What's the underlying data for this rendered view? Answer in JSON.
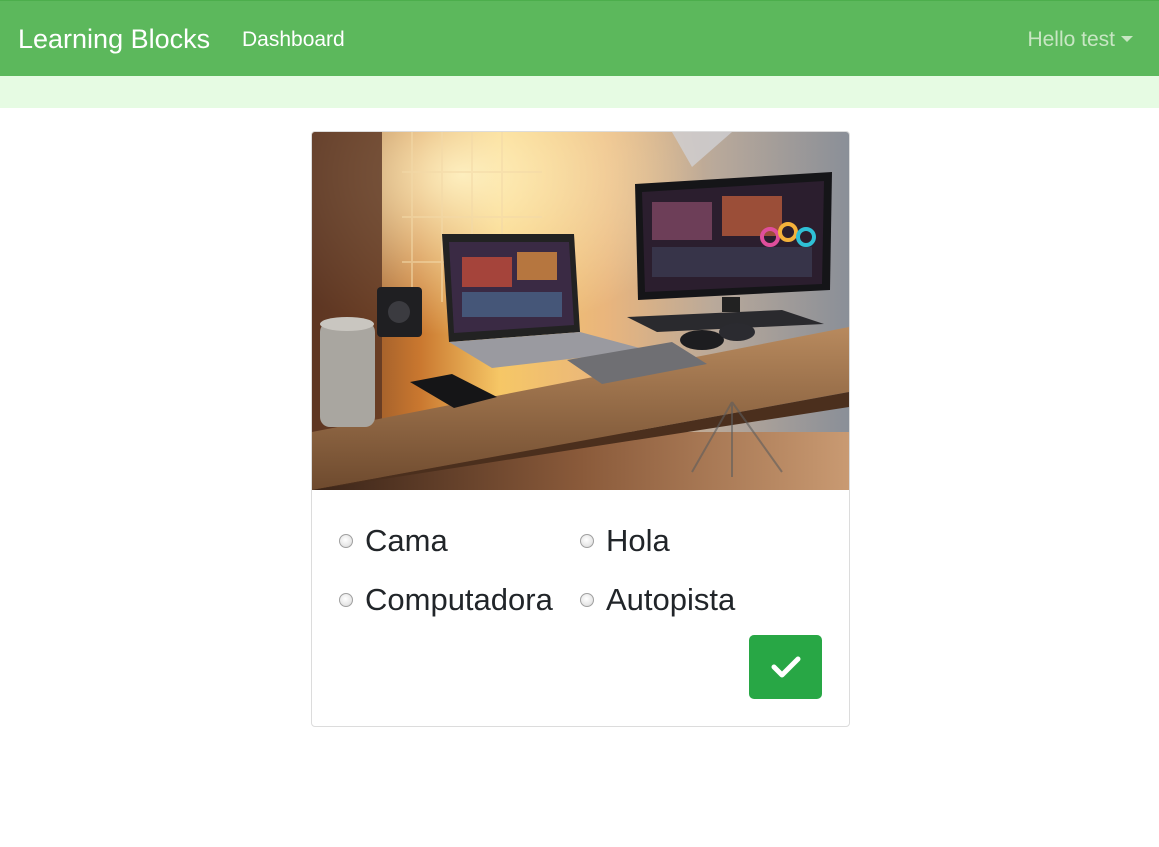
{
  "navbar": {
    "brand": "Learning Blocks",
    "links": [
      "Dashboard"
    ],
    "user_menu": "Hello test",
    "background_color": "#5cb85c"
  },
  "subbar": {
    "background_color": "#e6fbe3"
  },
  "quiz": {
    "options": [
      "Cama",
      "Hola",
      "Computadora",
      "Autopista"
    ],
    "selected": null,
    "submit_icon": "checkmark-icon",
    "submit_color": "#28a745"
  }
}
